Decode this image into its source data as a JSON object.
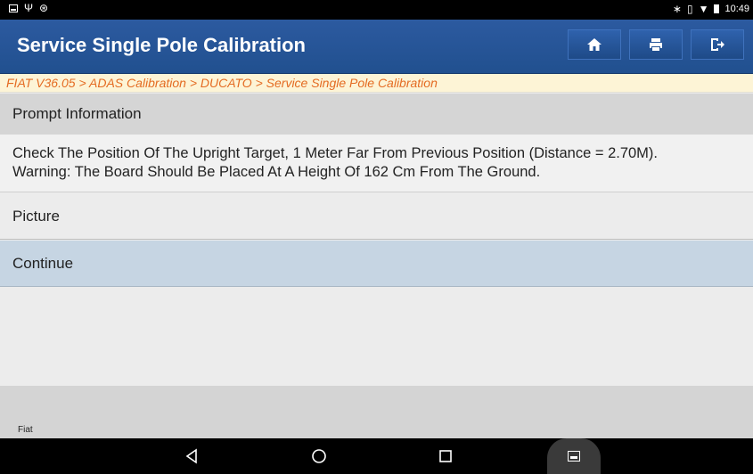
{
  "status_bar": {
    "left_icons": [
      "image-icon",
      "usb-icon",
      "bug-icon"
    ],
    "right_icons": [
      "bluetooth-icon",
      "vibrate-icon",
      "wifi-icon",
      "battery-icon"
    ],
    "time": "10:49"
  },
  "header": {
    "title": "Service Single Pole Calibration",
    "buttons": [
      {
        "name": "home-button",
        "icon": "home-icon"
      },
      {
        "name": "print-button",
        "icon": "print-icon"
      },
      {
        "name": "exit-button",
        "icon": "exit-icon"
      }
    ],
    "color": "#2658a0"
  },
  "breadcrumb": "FIAT V36.05 > ADAS Calibration > DUCATO > Service Single Pole Calibration",
  "prompt": {
    "header": "Prompt Information",
    "line1": "Check The Position Of The Upright Target, 1 Meter Far From Previous Position (Distance = 2.70M).",
    "line2": "Warning: The Board Should Be Placed At A Height Of 162 Cm From The Ground."
  },
  "options": [
    {
      "label": "Picture",
      "selected": false
    },
    {
      "label": "Continue",
      "selected": true
    }
  ],
  "footer": {
    "brand": "Fiat"
  },
  "navbar": {
    "icons": [
      "back-icon",
      "home-circle-icon",
      "recents-icon",
      "screenshot-icon"
    ]
  }
}
